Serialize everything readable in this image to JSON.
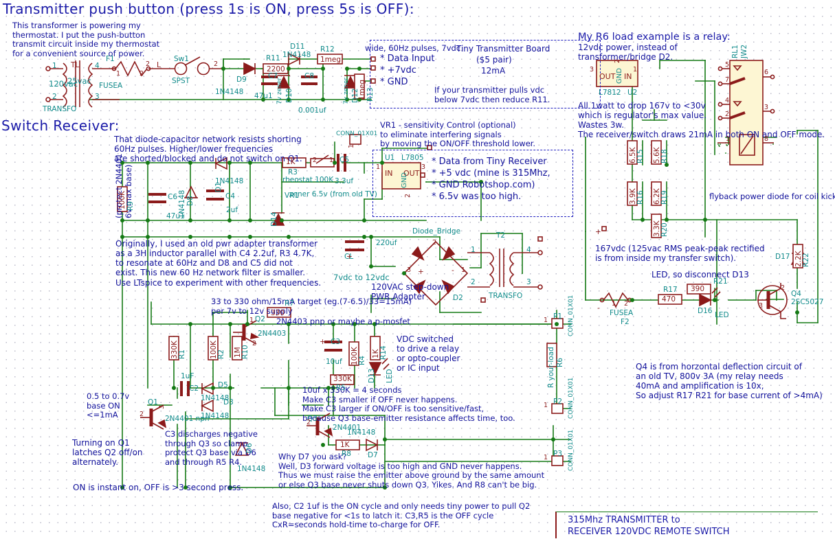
{
  "sheet": {
    "title_block": {
      "line1": "315Mhz TRANSMITTER to",
      "line2": "RECEIVER 120VDC REMOTE SWITCH"
    }
  },
  "headings": {
    "transmitter": "Transmitter push button (press 1s is ON, press 5s is OFF):",
    "receiver": "Switch Receiver:",
    "relay_example": "My R6 load example is a relay:"
  },
  "notes": {
    "thermostat": "This transformer is powering my\nthermostat. I put the push-button\ntransmit circuit inside my thermostat\nfor a convenient source of power.",
    "pulses": "wide, 60Hz pulses, 7vdc",
    "tx_board_title": "Tiny Transmitter Board",
    "tx_board_price": "($5 pair)",
    "tx_board_current": "12mA",
    "tx_board_note": "If your transmitter pulls vdc\nbelow 7vdc then reduce R11.",
    "tx_pins": [
      "Data Input",
      "+7vdc",
      "GND"
    ],
    "diode_cap": "That diode-capacitor network resists shorting\n60Hz pulses. Higher/lower frequencies\nare shorted/blocked and do not switch on Q1.",
    "vr1": "VR1 - sensitivity Control (optional)\nto eliminate interfering signals\nby moving the ON/OFF threshold lower.",
    "rx_data": [
      "Data from Tiny Receiver",
      "+5 vdc (mine is 315Mhz,",
      "GND Robotshop.com)",
      "6.5v was too high."
    ],
    "protect_q1": "(protect 2N4401\n6v max base)",
    "originally": "Originally, I used an old pwr adapter transformer\nas a 3H inductor parallel with C4 2.2uf, R3 4.7K,\nto resonate at 60Hz and D8 and C5 did not\nexist. This new 60 Hz network filter is smaller.\nUse LTspice to experiment with other frequencies.",
    "r7_note": "33 to 330 ohm/15mA target (eg.(7-6.5)/33=15mA)\nper 7v to 12v supply",
    "q2_note": "2N4403 pnp or maybe a p-mosfet",
    "vdc_switched": "VDC switched\nto drive a relay\nor opto-coupler\nor IC input",
    "base_on": "0.5 to 0.7v\nbase ON\n<=1mA",
    "turning_on": "Turning on Q1\nlatches Q2 off/on\nalternately.",
    "c3_note": "C3 discharges negative\nthrough Q3 so clamp\nprotect Q3 base via D6\nand through R5 R4.",
    "timing_note": "10uf x 330K = 4 seconds\nMake C3 smaller if OFF never happens.\nMake C3 larger if ON/OFF is too sensitive/fast,\nbecause Q3 base-emitter resistance affects time, too.",
    "d7_note": "Why D7 you ask?\nWell, D3 forward voltage is too high and GND never happens.\nThus we must raise the emitter above ground by the same amount\nor else Q3 base never shuts down Q3. Yikes. And R8 can't be big.",
    "on_instant": "ON is instant on, OFF is >3 second press.",
    "c2_note": "Also, C2 1uf is the ON cycle and only needs tiny power to pull Q2\nbase negative for <1s to latch it. C3,R5 is the OFF cycle\nCxR=seconds hold-time to-charge for OFF.",
    "twelve_vdc": "12vdc power, instead of\ntransformer/bridge D2.",
    "regulator_note": "All 1watt to drop 167v to <30v\nwhich is regulator's max value.\nWastes 3w.\nThe receiver/switch draws 21mA in both ON and OFF mode.",
    "v167": "167vdc (125vac RMS peak-peak rectified\nis from inside my transfer switch).",
    "led_note": "LED, so disconnect D13",
    "flyback": "flyback power diode for coil kickback",
    "q4_note": "Q4 is from horzontal deflection circuit of\nan old TV, 800v 3A (my relay needs\n40mA and amplification is 10x,\nSo adjust R17 R21 for base current of >4mA)",
    "pwr_adapter": "120VAC step-down\nPWR Adapter",
    "rail_7_12": "7vdc to 12vdc"
  },
  "transmitter": {
    "transformer": {
      "ref": "TL",
      "name": "TRANSFO",
      "primary": "120vac",
      "secondary": "25vac",
      "pins": [
        "1",
        "2",
        "3",
        "4"
      ]
    },
    "fuse": {
      "ref": "F1",
      "value": "FUSEA",
      "pins": [
        "1",
        "2"
      ]
    },
    "line_label": "L",
    "switch": {
      "ref": "Sw1",
      "value": "SPST",
      "pin_in": "2",
      "pin_out": "2"
    },
    "d9": {
      "ref": "D9",
      "value": "1N4148"
    },
    "r11": {
      "ref": "R11",
      "value": "2200"
    },
    "c7": {
      "ref": "C7",
      "value": "47u1"
    },
    "d10": {
      "ref": "D10",
      "value": "7v zener"
    },
    "c8": {
      "ref": "C8",
      "value": "0.001uf"
    },
    "d11": {
      "ref": "D11",
      "value": "1N4148"
    },
    "d12": {
      "ref": "D12",
      "value": "7v zener"
    },
    "r12": {
      "ref": "R12",
      "value": "1meg"
    },
    "r13": {
      "ref": "R13",
      "value": "1meg"
    }
  },
  "receiver": {
    "p4": {
      "ref": "CONN_01X01",
      "pin": "1"
    },
    "c5": {
      "ref": "C5",
      "value": "3.3uf"
    },
    "r3": {
      "ref": "R3",
      "value": "1K"
    },
    "vr1": {
      "ref": "VR1",
      "value": "rheostat 100K",
      "pins": [
        "1",
        "2"
      ]
    },
    "d1": {
      "ref": "D1",
      "value": "1N4148"
    },
    "d8": {
      "ref": "D8",
      "value": "1N4148"
    },
    "c4": {
      "ref": "C4",
      "value": "2uf"
    },
    "c6": {
      "ref": "C6",
      "value": "47u1"
    },
    "r9": {
      "ref": "R9",
      "value": "100K"
    },
    "d14": {
      "ref": "D14",
      "value": "zener 6.5v (from old TV)"
    },
    "u1": {
      "ref": "U1",
      "value": "L7805",
      "pins": [
        "IN",
        "OUT",
        "GND"
      ],
      "pin_nums": [
        "1",
        "3",
        "2"
      ]
    },
    "cl": {
      "ref": "CL",
      "value": "220uf"
    },
    "bridge": {
      "ref": "D2",
      "value": "Diode_Bridge",
      "pins": [
        "1",
        "2",
        "3",
        "4"
      ],
      "marks": [
        "+",
        "-"
      ]
    },
    "t2": {
      "ref": "T2",
      "value": "TRANSFO",
      "pins": [
        "1",
        "2",
        "3",
        "4"
      ]
    },
    "r7": {
      "ref": "R7",
      "value": "330"
    },
    "q2": {
      "ref": "Q2",
      "value": "2N4403",
      "pins": [
        "1",
        "2",
        "3"
      ]
    },
    "r10": {
      "ref": "R10",
      "value": "1M"
    },
    "r1": {
      "ref": "R1",
      "value": "330K"
    },
    "r2": {
      "ref": "R2",
      "value": "100K"
    },
    "c3": {
      "ref": "C3",
      "value": "10uf"
    },
    "r4": {
      "ref": "R4",
      "value": "100K"
    },
    "r14": {
      "ref": "R14",
      "value": "1K"
    },
    "d13": {
      "ref": "D13",
      "value": "LED"
    },
    "c2": {
      "ref": "C2",
      "value": "1uF"
    },
    "d5": {
      "ref": "D5",
      "value": "1N4148"
    },
    "d3": {
      "ref": "D3",
      "value": "1N4148"
    },
    "q1": {
      "ref": "Q1",
      "value": "2N4401 npn",
      "pins": [
        "2",
        "3"
      ]
    },
    "d6": {
      "ref": "D6",
      "value": "1N4148"
    },
    "q3": {
      "ref": "Q3",
      "value": "2N4401",
      "pins": [
        "2"
      ]
    },
    "r8": {
      "ref": "R8",
      "value": "1K"
    },
    "d7": {
      "ref": "D7",
      "value": "1N4148"
    },
    "r5": {
      "ref": "R5",
      "value": "330K"
    },
    "p1": {
      "ref": "CONN_01X01",
      "name": "P1",
      "pin": "1"
    },
    "p2": {
      "ref": "CONN_01X01",
      "name": "P2",
      "pin": "1"
    },
    "p3": {
      "ref": "CONN_01X01",
      "name": "P3",
      "pin": "1"
    },
    "r6": {
      "ref": "R6",
      "value": "R your-load"
    }
  },
  "relay_section": {
    "u2": {
      "ref": "U2",
      "value": "L7812",
      "pins": [
        "OUT",
        "IN",
        "GND"
      ],
      "pin_nums": [
        "3",
        "1",
        "2"
      ]
    },
    "rl1": {
      "ref": "RL1",
      "value": "JW2",
      "pins": [
        "5",
        "7",
        "4",
        "2",
        "6",
        "3",
        "1",
        "8"
      ]
    },
    "r15": {
      "ref": "R15",
      "value": "6.5K"
    },
    "r18": {
      "ref": "R18",
      "value": "5.6K"
    },
    "r16": {
      "ref": "R16",
      "value": "3.9K"
    },
    "r19": {
      "ref": "R19",
      "value": "6.2K"
    },
    "r20": {
      "ref": "R20",
      "value": "3.3K"
    },
    "r22": {
      "ref": "R22",
      "value": "2.2K"
    },
    "d17": {
      "ref": "D17",
      "value": ""
    },
    "f2": {
      "ref": "F2",
      "value": "FUSEA",
      "pins": [
        "1",
        "2"
      ]
    },
    "r17": {
      "ref": "R17",
      "value": "470"
    },
    "r21": {
      "ref": "R21",
      "value": "390"
    },
    "d16": {
      "ref": "D16",
      "value": "LED"
    },
    "q4": {
      "ref": "Q4",
      "value": "2SC5027",
      "pins": [
        "1",
        "2",
        "3"
      ]
    },
    "plus": "+",
    "minus": "-"
  },
  "colors": {
    "wire": "#157a15",
    "component": "#8b1a1a",
    "reference": "#0f8a8a",
    "note": "#11119b",
    "body_fill": "#fdf6d3"
  }
}
